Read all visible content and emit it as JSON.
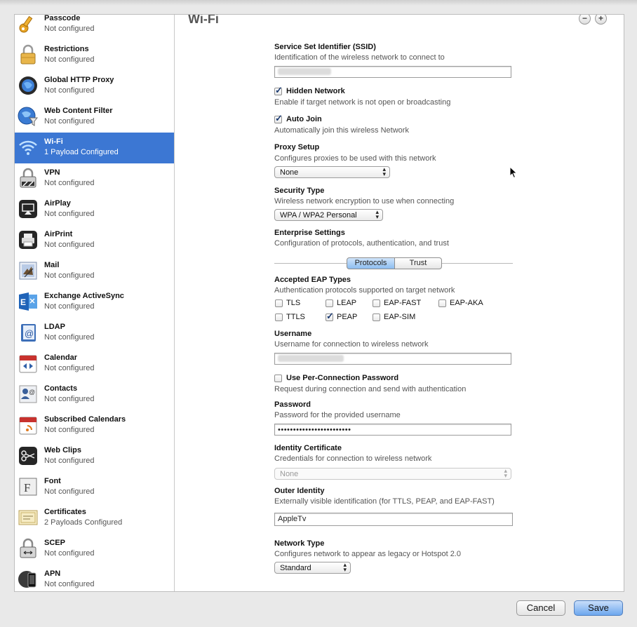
{
  "sidebar": {
    "items": [
      {
        "title": "Passcode",
        "subtitle": "Not configured",
        "icon": "key-icon"
      },
      {
        "title": "Restrictions",
        "subtitle": "Not configured",
        "icon": "padlock-icon"
      },
      {
        "title": "Global HTTP Proxy",
        "subtitle": "Not configured",
        "icon": "globe-icon"
      },
      {
        "title": "Web Content Filter",
        "subtitle": "Not configured",
        "icon": "globe-filter-icon"
      },
      {
        "title": "Wi-Fi",
        "subtitle": "1 Payload Configured",
        "icon": "wifi-icon"
      },
      {
        "title": "VPN",
        "subtitle": "Not configured",
        "icon": "vpn-lock-icon"
      },
      {
        "title": "AirPlay",
        "subtitle": "Not configured",
        "icon": "airplay-icon"
      },
      {
        "title": "AirPrint",
        "subtitle": "Not configured",
        "icon": "printer-icon"
      },
      {
        "title": "Mail",
        "subtitle": "Not configured",
        "icon": "mail-icon"
      },
      {
        "title": "Exchange ActiveSync",
        "subtitle": "Not configured",
        "icon": "exchange-icon"
      },
      {
        "title": "LDAP",
        "subtitle": "Not configured",
        "icon": "ldap-at-icon"
      },
      {
        "title": "Calendar",
        "subtitle": "Not configured",
        "icon": "calendar-icon"
      },
      {
        "title": "Contacts",
        "subtitle": "Not configured",
        "icon": "contacts-icon"
      },
      {
        "title": "Subscribed Calendars",
        "subtitle": "Not configured",
        "icon": "subscribed-calendar-icon"
      },
      {
        "title": "Web Clips",
        "subtitle": "Not configured",
        "icon": "webclip-scissors-icon"
      },
      {
        "title": "Font",
        "subtitle": "Not configured",
        "icon": "font-icon"
      },
      {
        "title": "Certificates",
        "subtitle": "2 Payloads Configured",
        "icon": "certificate-icon"
      },
      {
        "title": "SCEP",
        "subtitle": "Not configured",
        "icon": "scep-lock-icon"
      },
      {
        "title": "APN",
        "subtitle": "Not configured",
        "icon": "apn-phone-icon"
      }
    ],
    "selected": "Wi-Fi"
  },
  "main": {
    "title": "Wi-Fi",
    "minus_label": "−",
    "plus_label": "+",
    "ssid": {
      "label": "Service Set Identifier (SSID)",
      "desc": "Identification of the wireless network to connect to"
    },
    "hidden": {
      "label": "Hidden Network",
      "desc": "Enable if target network is not open or broadcasting",
      "checked": true
    },
    "autojoin": {
      "label": "Auto Join",
      "desc": "Automatically join this wireless Network",
      "checked": true
    },
    "proxy": {
      "label": "Proxy Setup",
      "desc": "Configures proxies to be used with this network",
      "value": "None"
    },
    "security": {
      "label": "Security Type",
      "desc": "Wireless network encryption to use when connecting",
      "value": "WPA / WPA2 Personal"
    },
    "enterprise": {
      "label": "Enterprise Settings",
      "desc": "Configuration of protocols, authentication, and trust"
    },
    "tabs": {
      "protocols": "Protocols",
      "trust": "Trust",
      "selected": "Protocols"
    },
    "eap": {
      "label": "Accepted EAP Types",
      "desc": "Authentication protocols supported on target network",
      "types": [
        {
          "name": "TLS",
          "checked": false
        },
        {
          "name": "LEAP",
          "checked": false
        },
        {
          "name": "EAP-FAST",
          "checked": false
        },
        {
          "name": "EAP-AKA",
          "checked": false
        },
        {
          "name": "TTLS",
          "checked": false
        },
        {
          "name": "PEAP",
          "checked": true
        },
        {
          "name": "EAP-SIM",
          "checked": false
        }
      ]
    },
    "username": {
      "label": "Username",
      "desc": "Username for connection to wireless network"
    },
    "perconn": {
      "label": "Use Per-Connection Password",
      "desc": "Request during connection and send with authentication",
      "checked": false
    },
    "password": {
      "label": "Password",
      "desc": "Password for the provided username",
      "value": "••••••••••••••••••••••••"
    },
    "identity_cert": {
      "label": "Identity Certificate",
      "desc": "Credentials for connection to wireless network",
      "value": "None"
    },
    "outer": {
      "label": "Outer Identity",
      "desc": "Externally visible identification (for TTLS, PEAP, and EAP-FAST)",
      "value": "AppleTv"
    },
    "network_type": {
      "label": "Network Type",
      "desc": "Configures network to appear as legacy or Hotspot 2.0",
      "value": "Standard"
    }
  },
  "footer": {
    "cancel": "Cancel",
    "save": "Save"
  },
  "colors": {
    "selection": "#3c77d3",
    "primary_button": "#6da7ee"
  }
}
